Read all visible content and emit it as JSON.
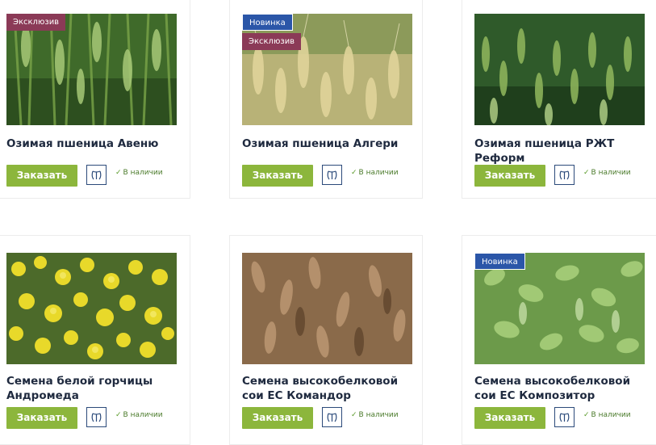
{
  "products": [
    {
      "title": "Озимая пшеница Авеню",
      "badges": [
        "Эксклюзив"
      ],
      "order_label": "Заказать",
      "stock_label": "В наличии",
      "check_mark": "✓"
    },
    {
      "title": "Озимая пшеница Алгери",
      "badges": [
        "Новинка",
        "Эксклюзив"
      ],
      "order_label": "Заказать",
      "stock_label": "В наличии",
      "check_mark": "✓"
    },
    {
      "title": "Озимая пшеница РЖТ Реформ",
      "badges": [],
      "order_label": "Заказать",
      "stock_label": "В наличии",
      "check_mark": "✓"
    },
    {
      "title": "Семена белой горчицы Андромеда",
      "badges": [],
      "order_label": "Заказать",
      "stock_label": "В наличии",
      "check_mark": "✓"
    },
    {
      "title": "Семена высокобелковой сои ЕС Командор",
      "badges": [],
      "order_label": "Заказать",
      "stock_label": "В наличии",
      "check_mark": "✓"
    },
    {
      "title": "Семена высокобелковой сои ЕС Композитор",
      "badges": [
        "Новинка"
      ],
      "order_label": "Заказать",
      "stock_label": "В наличии",
      "check_mark": "✓"
    }
  ],
  "colors": {
    "order_button": "#8cb63c",
    "badge_exclusive": "#8b3a57",
    "badge_new": "#2b56a8",
    "title": "#1f2a3f"
  },
  "icons": {
    "compare": "scales-icon",
    "check": "check-icon"
  }
}
